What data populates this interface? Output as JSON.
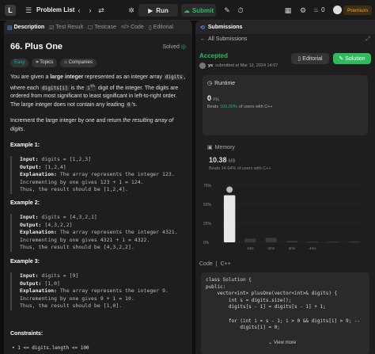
{
  "topbar": {
    "problem_list": "Problem List",
    "run": "Run",
    "submit": "Submit",
    "streak": "0",
    "premium": "Premium"
  },
  "left": {
    "tabs": [
      "Description",
      "Test Result",
      "Testcase",
      "Code",
      "Editorial"
    ],
    "title": "66. Plus One",
    "solved": "Solved",
    "chips": [
      "Easy",
      "Topics",
      "Companies"
    ],
    "desc_p1_a": "You are given a ",
    "desc_p1_b": "large integer",
    "desc_p1_c": " represented as an integer array ",
    "desc_p1_d": "digits",
    "desc_p1_e": ", where each ",
    "desc_p1_f": "digits[i]",
    "desc_p1_g": " is the ",
    "desc_p1_h": "i",
    "desc_p1_h_sup": "th",
    "desc_p1_i": " digit of the integer. The digits are ordered from most significant to least significant in left-to-right order. The large integer does not contain any leading ",
    "desc_p1_j": "0",
    "desc_p1_k": "'s.",
    "desc_p2_a": "Increment the large integer by one and return ",
    "desc_p2_b": "the resulting array of digits",
    "desc_p2_c": ".",
    "examples": [
      {
        "title": "Example 1:",
        "input": "digits = [1,2,3]",
        "output": "[1,2,4]",
        "explanation": "The array represents the integer 123.",
        "line2": "Incrementing by one gives 123 + 1 = 124.",
        "line3": "Thus, the result should be [1,2,4]."
      },
      {
        "title": "Example 2:",
        "input": "digits = [4,3,2,1]",
        "output": "[4,3,2,2]",
        "explanation": "The array represents the integer 4321.",
        "line2": "Incrementing by one gives 4321 + 1 = 4322.",
        "line3": "Thus, the result should be [4,3,2,2]."
      },
      {
        "title": "Example 3:",
        "input": "digits = [9]",
        "output": "[1,0]",
        "explanation": "The array represents the integer 9.",
        "line2": "Incrementing by one gives 9 + 1 = 10.",
        "line3": "Thus, the result should be [1,0]."
      }
    ],
    "labels": {
      "input": "Input:",
      "output": "Output:",
      "explanation": "Explanation:"
    },
    "constraints_title": "Constraints:",
    "constraint_1": "1 <= digits.length <= 100"
  },
  "right": {
    "tab": "Submissions",
    "all_submissions": "All Submissions",
    "status": "Accepted",
    "user": "ys",
    "submitted_at": "submitted at Mar 12, 2024 14:07",
    "editorial": "Editorial",
    "solution": "Solution",
    "runtime_label": "Runtime",
    "runtime_value": "0",
    "runtime_unit": "ms",
    "beats_label": "Beats",
    "runtime_beats": "100.00%",
    "beats_suffix": "of users with C++",
    "memory_label": "Memory",
    "memory_value": "10.38",
    "memory_unit": "MB",
    "memory_beats": "Beats 14.64% of users with C++",
    "code_label": "Code",
    "lang": "C++",
    "view_more": "View more",
    "code_lines": [
      "class Solution {",
      "public:",
      "    vector<int> plusOne(vector<int>& digits) {",
      "        int s = digits.size();",
      "        digits[s - 1] = digits[s - 1] + 1;",
      "",
      "        for (int i = s - 1; i > 0 && digits[i] > 9; --",
      "            digits[i] = 0;"
    ]
  },
  "chart_data": {
    "type": "bar",
    "y_ticks": [
      "75%",
      "50%",
      "25%",
      "0%"
    ],
    "x_ticks": [
      "1ms",
      "2ms",
      "3ms",
      "4ms"
    ],
    "ylim": [
      0,
      75
    ],
    "values": [
      62,
      5,
      6,
      2,
      1,
      1,
      1
    ],
    "highlight_index": 0,
    "bar_color": "#e8e8e8",
    "muted_color": "#3a3a3a"
  },
  "colors": {
    "accent_green": "#2cbb5d",
    "easy_teal": "#00b8a3",
    "premium": "#ffa116",
    "link_blue": "#5f9bff"
  }
}
